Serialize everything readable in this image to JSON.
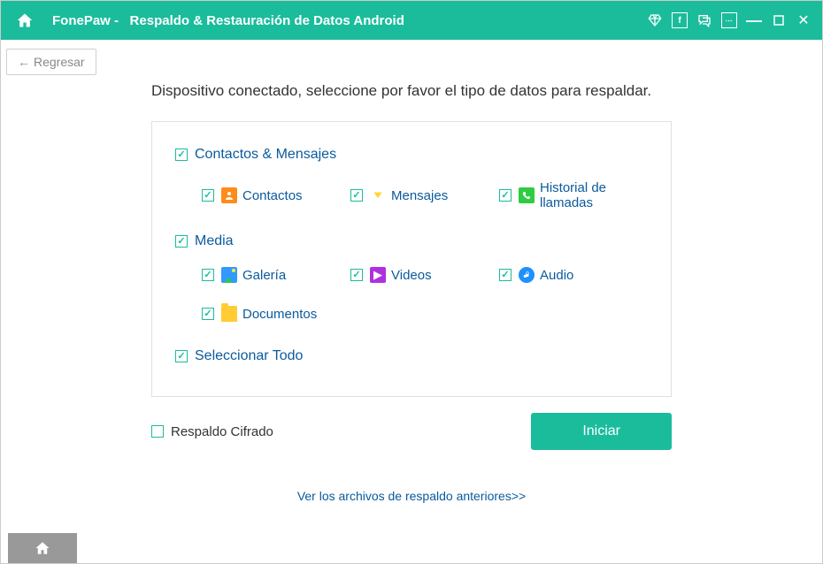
{
  "titlebar": {
    "brand": "FonePaw",
    "subtitle": "Respaldo & Restauración de Datos Android"
  },
  "back_label": "Regresar",
  "instruction": "Dispositivo conectado, seleccione por favor el tipo de datos para respaldar.",
  "categories": {
    "contacts_msgs": {
      "label": "Contactos & Mensajes"
    },
    "media": {
      "label": "Media"
    },
    "select_all": {
      "label": "Seleccionar Todo"
    }
  },
  "items": {
    "contactos": "Contactos",
    "mensajes": "Mensajes",
    "historial": "Historial de llamadas",
    "galeria": "Galería",
    "videos": "Videos",
    "audio": "Audio",
    "documentos": "Documentos"
  },
  "encrypted_label": "Respaldo Cifrado",
  "start_label": "Iniciar",
  "prev_link": "Ver los archivos de respaldo anteriores>>"
}
